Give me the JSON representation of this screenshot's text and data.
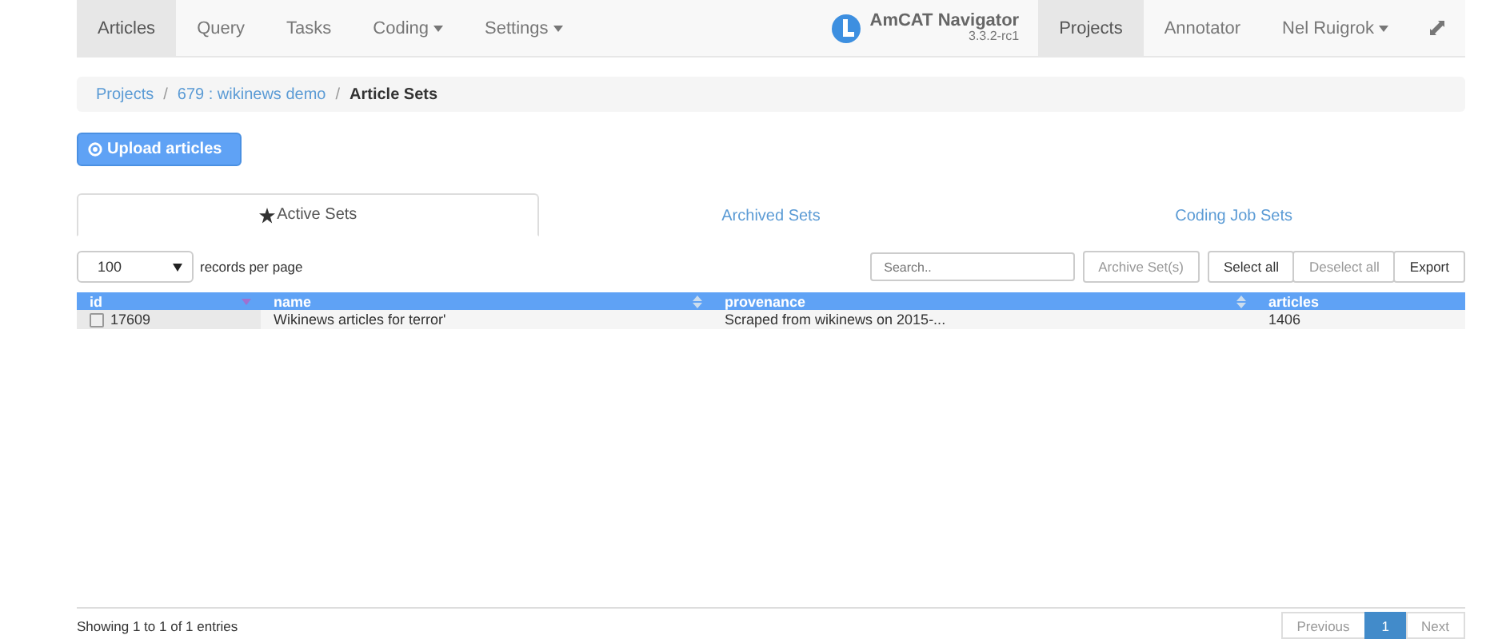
{
  "navbar": {
    "left_items": [
      {
        "label": "Articles",
        "selected": true,
        "dropdown": false
      },
      {
        "label": "Query",
        "selected": false,
        "dropdown": false
      },
      {
        "label": "Tasks",
        "selected": false,
        "dropdown": false
      },
      {
        "label": "Coding",
        "selected": false,
        "dropdown": true
      },
      {
        "label": "Settings",
        "selected": false,
        "dropdown": true
      }
    ],
    "brand": {
      "title": "AmCAT Navigator",
      "version": "3.3.2-rc1"
    },
    "right_items": [
      {
        "label": "Projects",
        "selected": true,
        "dropdown": false
      },
      {
        "label": "Annotator",
        "selected": false,
        "dropdown": false
      },
      {
        "label": "Nel Ruigrok",
        "selected": false,
        "dropdown": true
      }
    ]
  },
  "breadcrumb": [
    {
      "label": "Projects",
      "current": false
    },
    {
      "separator": "/",
      "label": "679 : wikinews demo",
      "current": false
    },
    {
      "separator": "/",
      "label": "Article Sets",
      "current": true
    }
  ],
  "upload_button": "Upload articles",
  "tabs": [
    {
      "label": "Active Sets",
      "selected": true,
      "starred": true
    },
    {
      "label": "Archived Sets",
      "selected": false,
      "starred": false
    },
    {
      "label": "Coding Job Sets",
      "selected": false,
      "starred": false
    }
  ],
  "page_size": {
    "value": "100",
    "label": "records per page"
  },
  "search": {
    "placeholder": "Search.."
  },
  "actions": [
    {
      "label": "Archive Set(s)",
      "disabled": true
    },
    {
      "label": "Select all",
      "disabled": false
    },
    {
      "label": "Deselect all",
      "disabled": true
    },
    {
      "label": "Export",
      "disabled": false
    }
  ],
  "table": {
    "columns": [
      "id",
      "name",
      "provenance",
      "articles"
    ],
    "rows": [
      {
        "checked": false,
        "cells": [
          "17609",
          "Wikinews articles for terror'",
          "Scraped from wikinews on 2015-...",
          "1406"
        ]
      }
    ]
  },
  "footer": {
    "info": "Showing 1 to 1 of 1 entries",
    "pagination": [
      {
        "label": "Previous",
        "selected": false
      },
      {
        "label": "1",
        "selected": true
      },
      {
        "label": "Next",
        "selected": false
      }
    ]
  }
}
